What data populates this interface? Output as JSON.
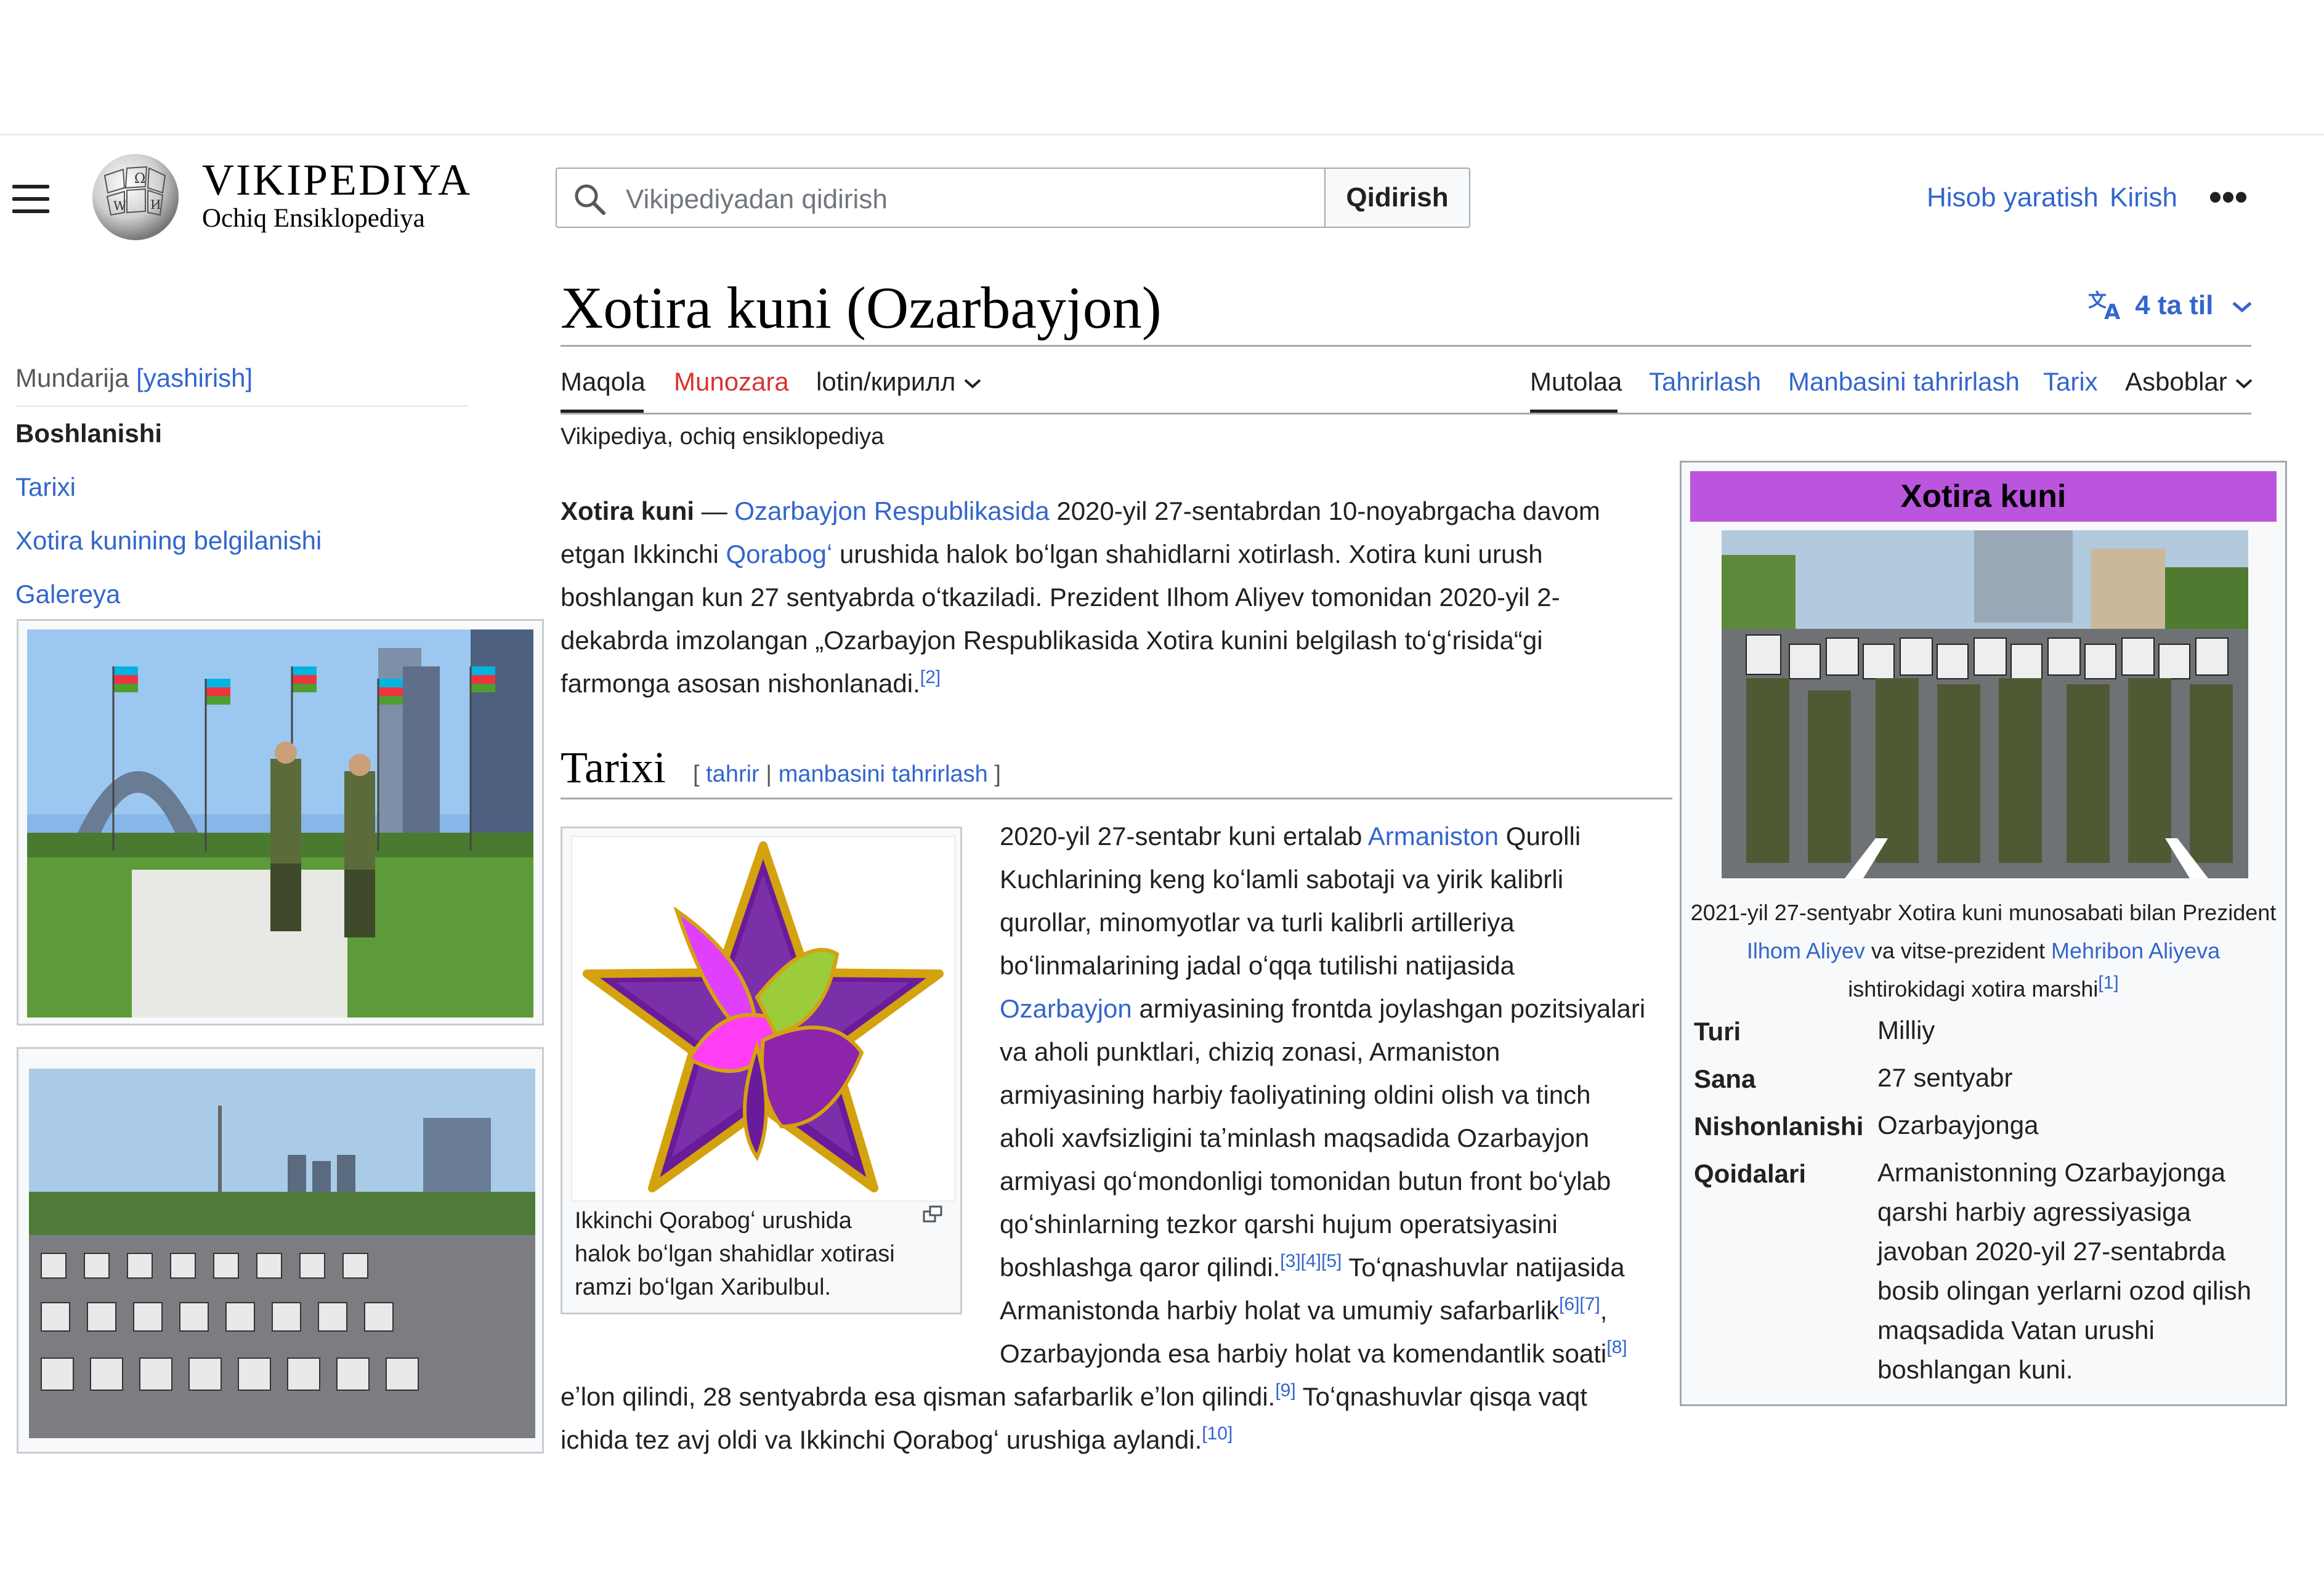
{
  "header": {
    "wordmark": "VIKIPEDIYA",
    "tagline": "Ochiq Ensiklopediya",
    "search_placeholder": "Vikipediyadan qidirish",
    "search_button": "Qidirish",
    "create_account": "Hisob yaratish",
    "login": "Kirish",
    "more": "•••"
  },
  "page": {
    "title": "Xotira kuni (Ozarbayjon)",
    "languages": "4 ta til",
    "subtitle": "Vikipediya, ochiq ensiklopediya"
  },
  "tabs": {
    "article": "Maqola",
    "talk": "Munozara",
    "variant": "lotin/кирилл",
    "read": "Mutolaa",
    "edit": "Tahrirlash",
    "edit_source": "Manbasini tahrirlash",
    "history": "Tarix",
    "tools": "Asboblar"
  },
  "toc": {
    "heading": "Mundarija",
    "hide": "[yashirish]",
    "items": [
      "Boshlanishi",
      "Tarixi",
      "Xotira kunining belgilanishi",
      "Galereya"
    ]
  },
  "intro": {
    "bold": "Xotira kuni",
    "dash": " — ",
    "link1": "Ozarbayjon Respublikasida",
    "t1": " 2020-yil 27-sentabrdan 10-noyabrgacha davom",
    "t2a": "etgan Ikkinchi ",
    "link2": "Qorabogʻ",
    "t2b": " urushida halok boʻlgan shahidlarni xotirlash. Xotira kuni urush",
    "t3": "boshlangan kun 27 sentyabrda oʻtkaziladi. Prezident Ilhom Aliyev tomonidan 2020-yil 2-",
    "t4": "dekabrda imzolangan „Ozarbayjon Respublikasida Xotira kunini belgilash toʻgʻrisida“gi",
    "t5": "farmonga asosan nishonlanadi.",
    "ref": "[2]"
  },
  "section": {
    "heading": "Tarixi",
    "edit_open": "[ ",
    "edit": "tahrir",
    "sep": " | ",
    "edit_source": "manbasini tahrirlash",
    "edit_close": " ]"
  },
  "figure": {
    "caption": "Ikkinchi Qorabogʻ urushida halok boʻlgan shahidlar xotirasi ramzi boʻlgan Xaribulbul."
  },
  "history": {
    "l1a": "2020-yil 27-sentabr kuni ertalab ",
    "l1link": "Armaniston",
    "l1b": " Qurolli",
    "l2": "Kuchlarining keng koʻlamli sabotaji va yirik kalibrli",
    "l3": "qurollar, minomyotlar va turli kalibrli artilleriya",
    "l4": "boʻlinmalarining jadal oʻqqa tutilishi natijasida",
    "l5link": "Ozarbayjon",
    "l5b": " armiyasining frontda joylashgan pozitsiyalari",
    "l6": "va aholi punktlari, chiziq zonasi, Armaniston",
    "l7": "armiyasining harbiy faoliyatining oldini olish va tinch",
    "l8": "aholi xavfsizligini taʼminlash maqsadida Ozarbayjon",
    "l9": "armiyasi qoʻmondonligi tomonidan butun front boʻylab",
    "l10": "qoʻshinlarning tezkor qarshi hujum operatsiyasini",
    "l11a": "boshlashga qaror qilindi.",
    "l11ref": "[3][4][5]",
    "l11b": " Toʻqnashuvlar natijasida",
    "l12a": "Armanistonda harbiy holat va umumiy safarbarlik",
    "l12ref": "[6][7]",
    "l12b": ",",
    "l13a": "Ozarbayjonda esa harbiy holat va komendantlik soati",
    "l13ref": "[8]",
    "l14a": "eʼlon qilindi, 28 sentyabrda esa qisman safarbarlik eʼlon qilindi.",
    "l14ref": "[9]",
    "l14b": " Toʻqnashuvlar qisqa vaqt",
    "l15a": "ichida tez avj oldi va Ikkinchi Qorabogʻ urushiga aylandi.",
    "l15ref": "[10]"
  },
  "infobox": {
    "title": "Xotira kuni",
    "cap1": "2021-yil 27-sentyabr Xotira kuni munosabati bilan Prezident",
    "cap2link1": "Ilhom Aliyev",
    "cap2mid": " va vitse-prezident ",
    "cap2link2": "Mehribon Aliyeva",
    "cap3": "ishtirokidagi xotira marshi",
    "cap3ref": "[1]",
    "rows": [
      {
        "label": "Turi",
        "value": "Milliy"
      },
      {
        "label": "Sana",
        "value": "27 sentyabr"
      },
      {
        "label": "Nishonlanishi",
        "value": "Ozarbayjonga"
      },
      {
        "label": "Qoidalari",
        "lines": [
          "Armanistonning Ozarbayjonga",
          "qarshi harbiy agressiyasiga",
          "javoban 2020-yil 27-sentabrda",
          "bosib olingan yerlarni ozod qilish",
          "maqsadida Vatan urushi",
          "boshlangan kuni."
        ]
      }
    ],
    "title_color": "#bb55dd"
  }
}
